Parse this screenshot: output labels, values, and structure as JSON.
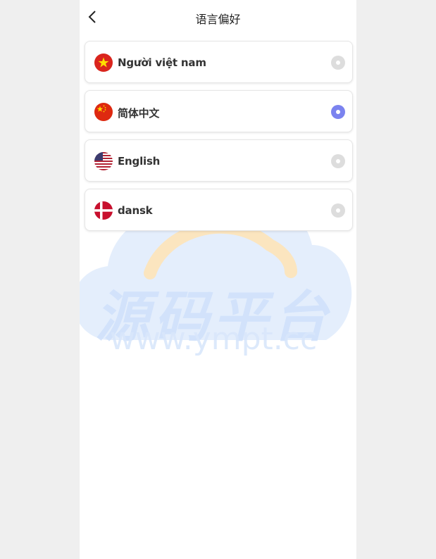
{
  "header": {
    "title": "语言偏好"
  },
  "languages": [
    {
      "label": "Người việt nam",
      "flag": "vietnam-flag-icon",
      "selected": false
    },
    {
      "label": "简体中文",
      "flag": "china-flag-icon",
      "selected": true
    },
    {
      "label": "English",
      "flag": "usa-flag-icon",
      "selected": false
    },
    {
      "label": "dansk",
      "flag": "denmark-flag-icon",
      "selected": false
    }
  ],
  "watermark": {
    "text": "源码平台",
    "url": "www.ympt.cc"
  },
  "colors": {
    "accent": "#7b83ef",
    "radio_off": "#dddddd",
    "background": "#efefef"
  }
}
